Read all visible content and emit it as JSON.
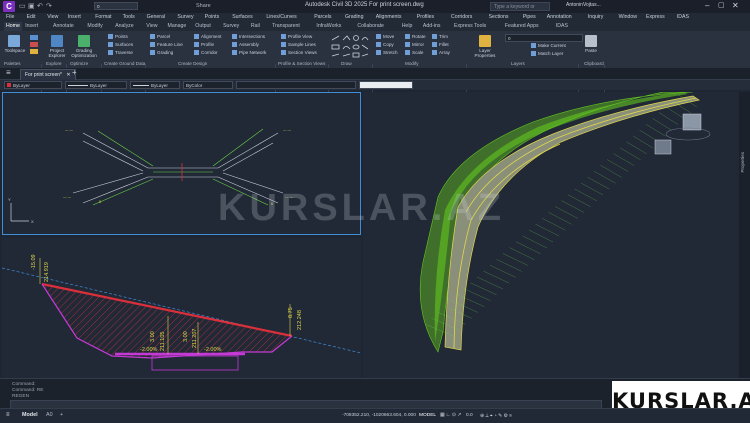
{
  "titlebar": {
    "logo": "C",
    "title": "Autodesk Civil 3D 2025   For print screen.dwg",
    "search_placeholder": "Type a keyword or phrase",
    "user": "AntoninVojtas...",
    "share": "Share",
    "layer_value": "0"
  },
  "menu": [
    "File",
    "Edit",
    "View",
    "Insert",
    "Format",
    "Tools",
    "General",
    "Survey",
    "Points",
    "Surfaces",
    "Lines/Curves",
    "Parcels",
    "Grading",
    "Alignments",
    "Profiles",
    "Corridors",
    "Sections",
    "Pipes",
    "Annotation",
    "Inquiry",
    "Window",
    "Express",
    "IDAS"
  ],
  "tabs": [
    "Home",
    "Insert",
    "Annotate",
    "Modify",
    "Analyze",
    "View",
    "Manage",
    "Output",
    "Survey",
    "Rail",
    "Transparent",
    "InfraWorks",
    "Collaborate",
    "Help",
    "Add-ins",
    "Express Tools",
    "Featured Apps",
    "IDAS"
  ],
  "ribbon": {
    "toolspace": "Toolspace",
    "project_explorer": "Project Explorer",
    "grading_optimization": "Grading Optimization",
    "ground_data": [
      "Points",
      "Surfaces",
      "Traverse"
    ],
    "design_col1": [
      "Parcel",
      "Feature Line",
      "Grading"
    ],
    "design_col2": [
      "Alignment",
      "Profile",
      "Corridor"
    ],
    "design_col3": [
      "Intersections",
      "Assembly",
      "Pipe Network"
    ],
    "profile_section": [
      "Profile View",
      "Sample Lines",
      "Section Views"
    ],
    "modify_col1": [
      "Move",
      "Copy",
      "Stretch"
    ],
    "modify_col2": [
      "Rotate",
      "Mirror",
      "Scale"
    ],
    "modify_col3": [
      "Trim",
      "Fillet",
      "Array"
    ],
    "layers": [
      "Make Current",
      "Match Layer"
    ],
    "layer_properties": "Layer Properties",
    "paste": "Paste",
    "panels": [
      "Palettes",
      "Explore",
      "Optimize",
      "Create Ground Data",
      "Create Design",
      "Profile & Section Views",
      "Draw",
      "Modify",
      "Layers",
      "Clipboard"
    ]
  },
  "document": {
    "tab": "For print screen*",
    "combo_layer": "ByLayer",
    "combo_linetype": "ByLayer",
    "combo_lineweight": "ByLayer",
    "combo_color": "ByColor"
  },
  "section": {
    "labels": [
      "-15.09",
      "214.919",
      "-2.00%",
      "-2.00%",
      "3.00",
      "211.105",
      "3.00",
      "211.207",
      "8.75",
      "212.248"
    ]
  },
  "command": {
    "lines": [
      "Command:",
      "Command: RE",
      "REGEN"
    ]
  },
  "status": {
    "model": "Model",
    "layout": "A0",
    "coords": "-708352.210, -1020663.604, 0.000",
    "model_btn": "MODEL",
    "scale": "0.0"
  },
  "watermark": {
    "text": "KURSLAR.AZ",
    "badge": "KURSLAR.AZ"
  },
  "viewcube": {
    "label": "Properties"
  },
  "colors": {
    "accent": "#3f8ed6",
    "road": "#9aa64a",
    "green": "#63c61e",
    "cut": "#d9303b",
    "magenta": "#c53ad6"
  }
}
